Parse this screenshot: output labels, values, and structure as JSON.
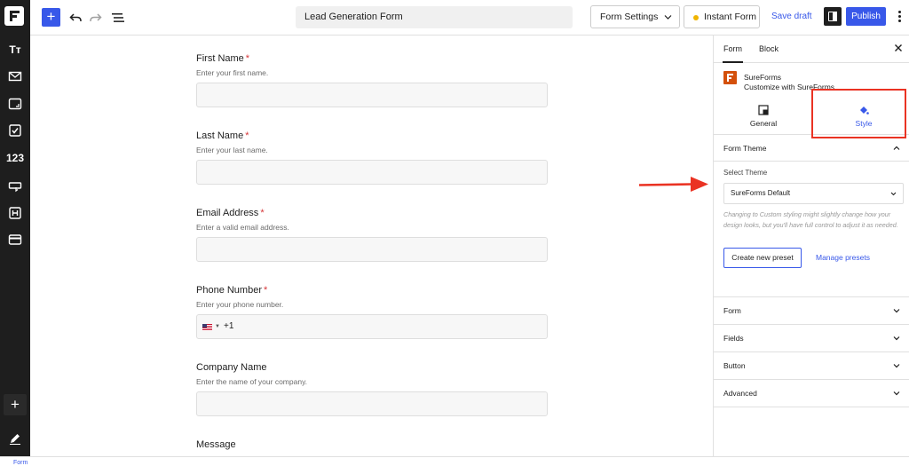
{
  "app": {
    "brand_icon": "sureforms-logo"
  },
  "rail": {
    "items": [
      {
        "name": "typography-icon",
        "glyph": "Tт"
      },
      {
        "name": "mail-icon"
      },
      {
        "name": "input-field-icon"
      },
      {
        "name": "checkbox-icon"
      },
      {
        "name": "number-icon",
        "glyph": "123"
      },
      {
        "name": "button-icon"
      },
      {
        "name": "heading-icon"
      },
      {
        "name": "card-icon"
      }
    ],
    "add_label": "+",
    "edit_icon": "pencil-icon"
  },
  "toolbar": {
    "add_label": "+",
    "title": "Lead Generation Form",
    "form_settings_label": "Form Settings",
    "instant_form_label": "Instant Form",
    "save_draft_label": "Save draft",
    "publish_label": "Publish",
    "accent_color": "#3858e9"
  },
  "form": {
    "fields": [
      {
        "label": "First Name",
        "required": "*",
        "help": "Enter your first name."
      },
      {
        "label": "Last Name",
        "required": "*",
        "help": "Enter your last name."
      },
      {
        "label": "Email Address",
        "required": "*",
        "help": "Enter a valid email address."
      },
      {
        "label": "Phone Number",
        "required": "*",
        "help": "Enter your phone number.",
        "country_code": "+1"
      },
      {
        "label": "Company Name",
        "required": "",
        "help": "Enter the name of your company."
      },
      {
        "label": "Message",
        "required": "",
        "help": ""
      }
    ]
  },
  "sidebar": {
    "tabs": [
      "Form",
      "Block"
    ],
    "plugin_name": "SureForms",
    "plugin_desc": "Customize with SureForms",
    "general_label": "General",
    "style_label": "Style",
    "form_theme_title": "Form Theme",
    "select_theme_label": "Select Theme",
    "theme_value": "SureForms Default",
    "theme_note": "Changing to Custom styling might slightly change how your design looks, but you'll have full control to adjust it as needed.",
    "create_preset_label": "Create new preset",
    "manage_presets_label": "Manage presets",
    "accordions": [
      "Form",
      "Fields",
      "Button",
      "Advanced"
    ],
    "highlight_color": "#ea3323"
  },
  "bottombar": {
    "breadcrumb": "Form"
  }
}
